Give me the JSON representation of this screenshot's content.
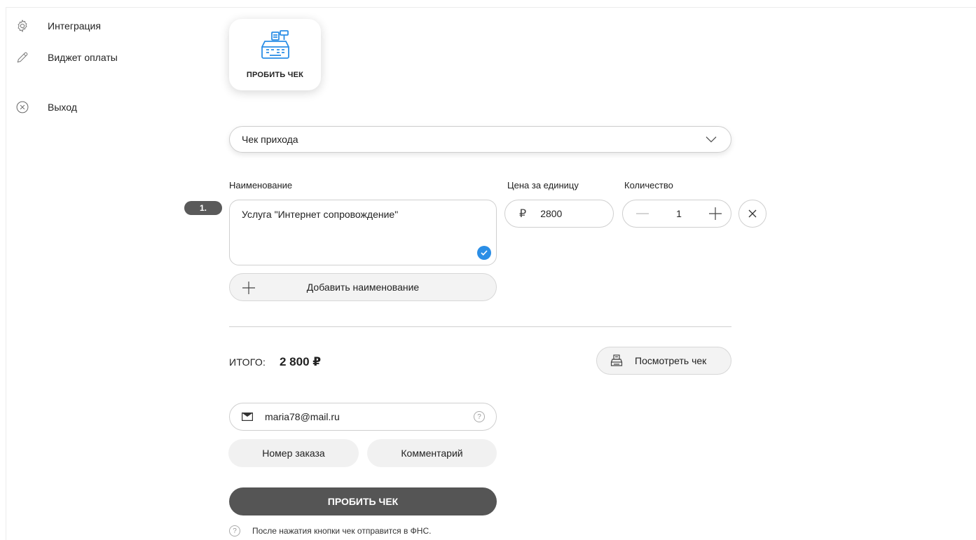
{
  "sidebar": {
    "items": [
      {
        "label": "Интеграция",
        "icon": "gear-icon"
      },
      {
        "label": "Виджет оплаты",
        "icon": "pencil-icon"
      },
      {
        "label": "Выход",
        "icon": "close-circle-icon"
      }
    ]
  },
  "card": {
    "label": "ПРОБИТЬ ЧЕК",
    "icon": "cash-register-icon"
  },
  "receipt_type": {
    "selected": "Чек прихода"
  },
  "columns": {
    "name": "Наименование",
    "price": "Цена за единицу",
    "quantity": "Количество"
  },
  "items": [
    {
      "index": "1.",
      "name": "Услуга \"Интернет сопровождение\"",
      "currency": "₽",
      "price": "2800",
      "quantity": "1"
    }
  ],
  "add_item_label": "Добавить наименование",
  "total": {
    "label": "ИТОГО:",
    "value": "2 800 ₽"
  },
  "view_receipt_label": "Посмотреть чек",
  "email": {
    "value": "maria78@mail.ru",
    "help": "?"
  },
  "order_number_label": "Номер заказа",
  "comment_label": "Комментарий",
  "submit_label": "ПРОБИТЬ ЧЕК",
  "note": {
    "help": "?",
    "text": "После нажатия кнопки чек отправится в ФНС."
  },
  "colors": {
    "accent": "#2b8ee6",
    "submit": "#555555",
    "badge": "#5a5a5a"
  }
}
